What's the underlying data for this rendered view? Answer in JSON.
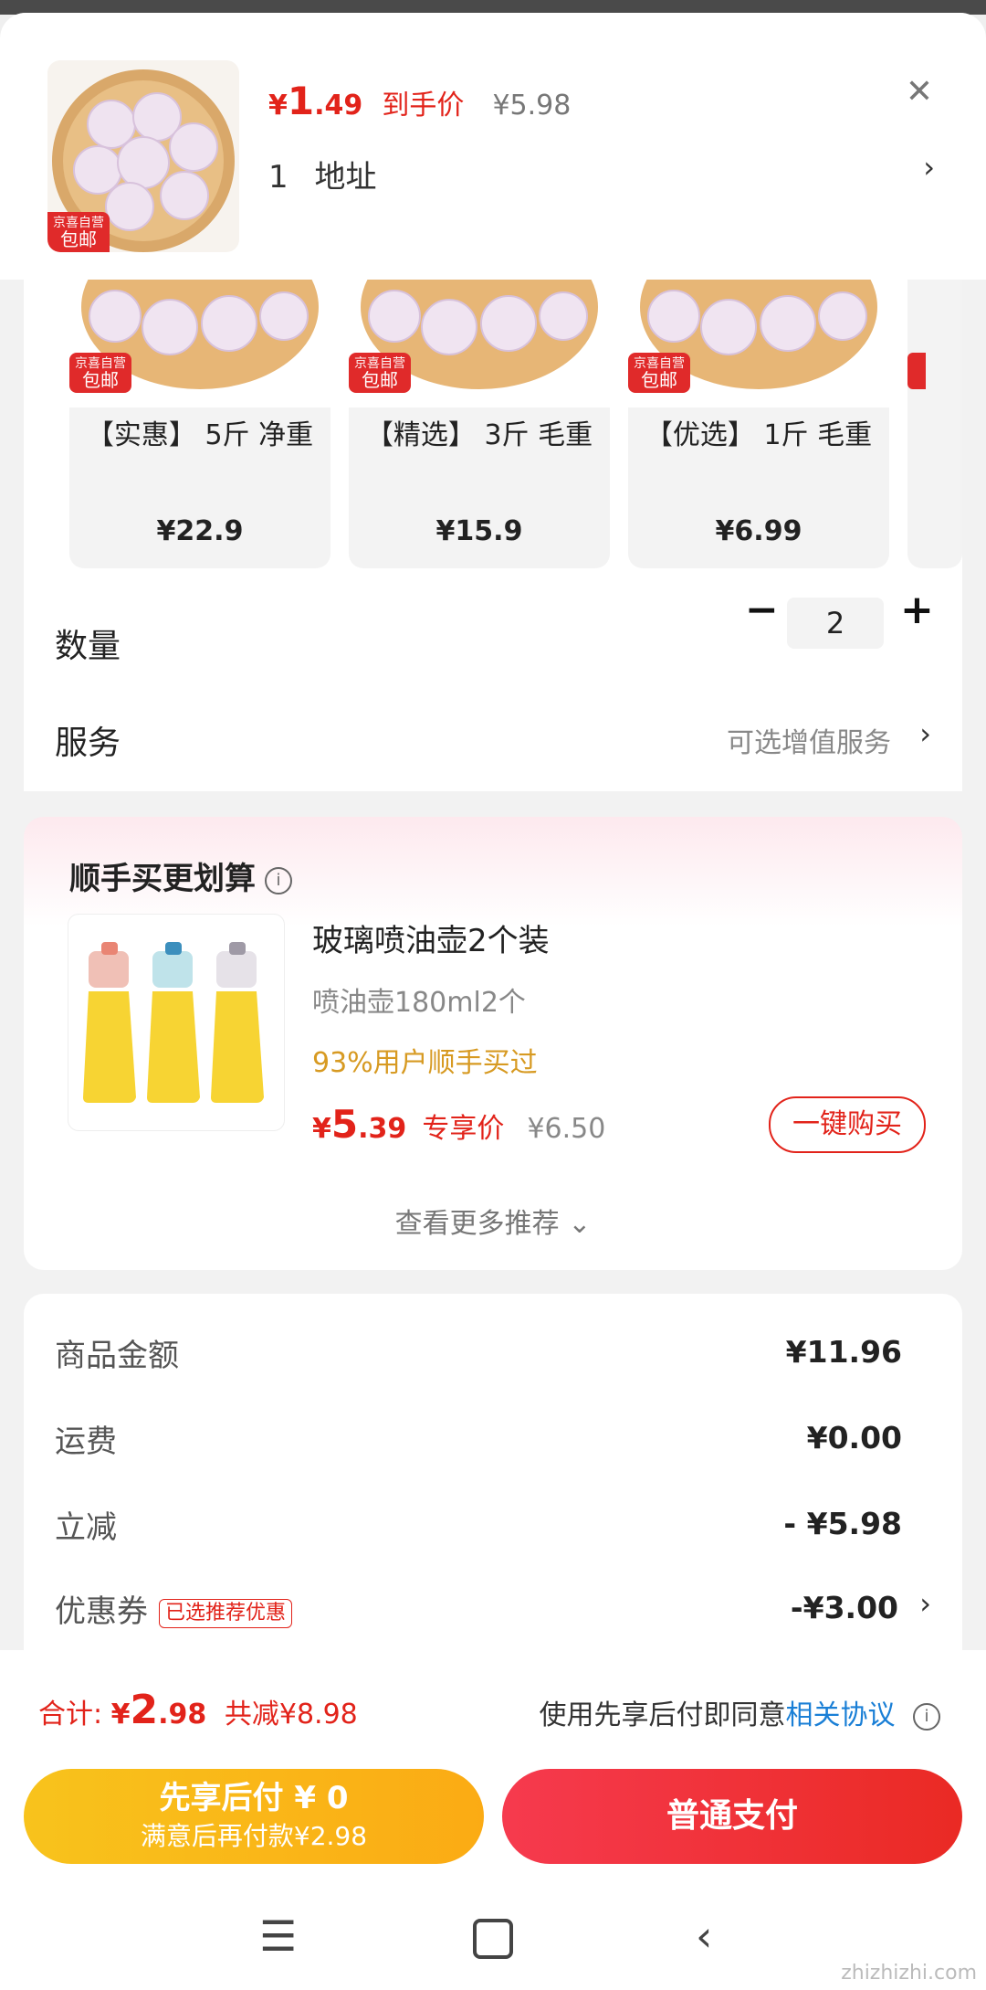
{
  "header": {
    "price_symbol": "¥",
    "price_int": "1",
    "price_dec": ".49",
    "price_tag": "到手价",
    "orig_price": "¥5.98",
    "address_count": "1",
    "address_label": "地址",
    "badge_top": "京喜自营",
    "badge_bottom": "包邮"
  },
  "variants": [
    {
      "name": "【实惠】 5斤 净重",
      "price": "¥22.9"
    },
    {
      "name": "【精选】 3斤 毛重",
      "price": "¥15.9"
    },
    {
      "name": "【优选】 1斤 毛重",
      "price": "¥6.99"
    }
  ],
  "quantity": {
    "label": "数量",
    "value": "2"
  },
  "service": {
    "label": "服务",
    "value": "可选增值服务"
  },
  "recommend": {
    "title": "顺手买更划算",
    "product_name": "玻璃喷油壶2个装",
    "spec": "喷油壶180ml2个",
    "buyers": "93%用户顺手买过",
    "price_symbol": "¥",
    "price_int": "5",
    "price_dec": ".39",
    "price_tag": "专享价",
    "orig_price": "¥6.50",
    "buy_button": "一键购买",
    "more": "查看更多推荐"
  },
  "summary": {
    "items_label": "商品金额",
    "items_value": "¥11.96",
    "shipping_label": "运费",
    "shipping_value": "¥0.00",
    "discount_label": "立减",
    "discount_value": "- ¥5.98",
    "coupon_label": "优惠券",
    "coupon_tag": "已选推荐优惠",
    "coupon_value": "-¥3.00"
  },
  "bottom": {
    "total_label": "合计:",
    "total_symbol": "¥",
    "total_int": "2",
    "total_dec": ".98",
    "total_saved": "共减¥8.98",
    "agree_text": "使用先享后付即同意",
    "agree_link": "相关协议",
    "pay_later_title": "先享后付 ¥ 0",
    "pay_later_sub": "满意后再付款¥2.98",
    "pay_normal": "普通支付"
  },
  "watermark": "zhizhizhi.com",
  "colors": {
    "accent_red": "#e2231a",
    "pay_yellow": "#fbb816",
    "link_blue": "#1a7fd6"
  }
}
